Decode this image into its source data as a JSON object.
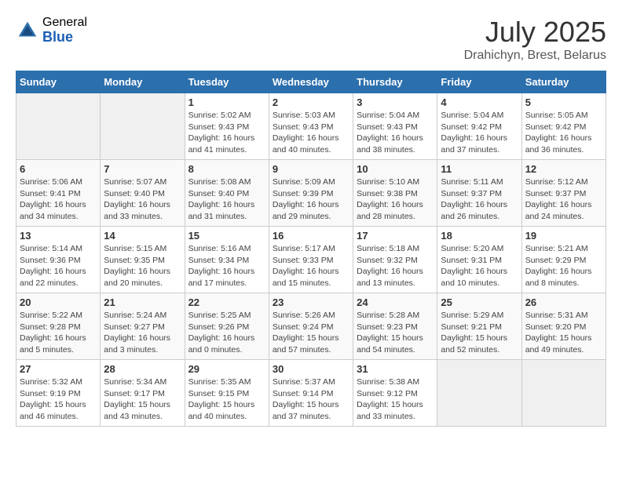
{
  "header": {
    "logo_general": "General",
    "logo_blue": "Blue",
    "month_year": "July 2025",
    "location": "Drahichyn, Brest, Belarus"
  },
  "days_of_week": [
    "Sunday",
    "Monday",
    "Tuesday",
    "Wednesday",
    "Thursday",
    "Friday",
    "Saturday"
  ],
  "weeks": [
    [
      {
        "day": "",
        "info": ""
      },
      {
        "day": "",
        "info": ""
      },
      {
        "day": "1",
        "info": "Sunrise: 5:02 AM\nSunset: 9:43 PM\nDaylight: 16 hours\nand 41 minutes."
      },
      {
        "day": "2",
        "info": "Sunrise: 5:03 AM\nSunset: 9:43 PM\nDaylight: 16 hours\nand 40 minutes."
      },
      {
        "day": "3",
        "info": "Sunrise: 5:04 AM\nSunset: 9:43 PM\nDaylight: 16 hours\nand 38 minutes."
      },
      {
        "day": "4",
        "info": "Sunrise: 5:04 AM\nSunset: 9:42 PM\nDaylight: 16 hours\nand 37 minutes."
      },
      {
        "day": "5",
        "info": "Sunrise: 5:05 AM\nSunset: 9:42 PM\nDaylight: 16 hours\nand 36 minutes."
      }
    ],
    [
      {
        "day": "6",
        "info": "Sunrise: 5:06 AM\nSunset: 9:41 PM\nDaylight: 16 hours\nand 34 minutes."
      },
      {
        "day": "7",
        "info": "Sunrise: 5:07 AM\nSunset: 9:40 PM\nDaylight: 16 hours\nand 33 minutes."
      },
      {
        "day": "8",
        "info": "Sunrise: 5:08 AM\nSunset: 9:40 PM\nDaylight: 16 hours\nand 31 minutes."
      },
      {
        "day": "9",
        "info": "Sunrise: 5:09 AM\nSunset: 9:39 PM\nDaylight: 16 hours\nand 29 minutes."
      },
      {
        "day": "10",
        "info": "Sunrise: 5:10 AM\nSunset: 9:38 PM\nDaylight: 16 hours\nand 28 minutes."
      },
      {
        "day": "11",
        "info": "Sunrise: 5:11 AM\nSunset: 9:37 PM\nDaylight: 16 hours\nand 26 minutes."
      },
      {
        "day": "12",
        "info": "Sunrise: 5:12 AM\nSunset: 9:37 PM\nDaylight: 16 hours\nand 24 minutes."
      }
    ],
    [
      {
        "day": "13",
        "info": "Sunrise: 5:14 AM\nSunset: 9:36 PM\nDaylight: 16 hours\nand 22 minutes."
      },
      {
        "day": "14",
        "info": "Sunrise: 5:15 AM\nSunset: 9:35 PM\nDaylight: 16 hours\nand 20 minutes."
      },
      {
        "day": "15",
        "info": "Sunrise: 5:16 AM\nSunset: 9:34 PM\nDaylight: 16 hours\nand 17 minutes."
      },
      {
        "day": "16",
        "info": "Sunrise: 5:17 AM\nSunset: 9:33 PM\nDaylight: 16 hours\nand 15 minutes."
      },
      {
        "day": "17",
        "info": "Sunrise: 5:18 AM\nSunset: 9:32 PM\nDaylight: 16 hours\nand 13 minutes."
      },
      {
        "day": "18",
        "info": "Sunrise: 5:20 AM\nSunset: 9:31 PM\nDaylight: 16 hours\nand 10 minutes."
      },
      {
        "day": "19",
        "info": "Sunrise: 5:21 AM\nSunset: 9:29 PM\nDaylight: 16 hours\nand 8 minutes."
      }
    ],
    [
      {
        "day": "20",
        "info": "Sunrise: 5:22 AM\nSunset: 9:28 PM\nDaylight: 16 hours\nand 5 minutes."
      },
      {
        "day": "21",
        "info": "Sunrise: 5:24 AM\nSunset: 9:27 PM\nDaylight: 16 hours\nand 3 minutes."
      },
      {
        "day": "22",
        "info": "Sunrise: 5:25 AM\nSunset: 9:26 PM\nDaylight: 16 hours\nand 0 minutes."
      },
      {
        "day": "23",
        "info": "Sunrise: 5:26 AM\nSunset: 9:24 PM\nDaylight: 15 hours\nand 57 minutes."
      },
      {
        "day": "24",
        "info": "Sunrise: 5:28 AM\nSunset: 9:23 PM\nDaylight: 15 hours\nand 54 minutes."
      },
      {
        "day": "25",
        "info": "Sunrise: 5:29 AM\nSunset: 9:21 PM\nDaylight: 15 hours\nand 52 minutes."
      },
      {
        "day": "26",
        "info": "Sunrise: 5:31 AM\nSunset: 9:20 PM\nDaylight: 15 hours\nand 49 minutes."
      }
    ],
    [
      {
        "day": "27",
        "info": "Sunrise: 5:32 AM\nSunset: 9:19 PM\nDaylight: 15 hours\nand 46 minutes."
      },
      {
        "day": "28",
        "info": "Sunrise: 5:34 AM\nSunset: 9:17 PM\nDaylight: 15 hours\nand 43 minutes."
      },
      {
        "day": "29",
        "info": "Sunrise: 5:35 AM\nSunset: 9:15 PM\nDaylight: 15 hours\nand 40 minutes."
      },
      {
        "day": "30",
        "info": "Sunrise: 5:37 AM\nSunset: 9:14 PM\nDaylight: 15 hours\nand 37 minutes."
      },
      {
        "day": "31",
        "info": "Sunrise: 5:38 AM\nSunset: 9:12 PM\nDaylight: 15 hours\nand 33 minutes."
      },
      {
        "day": "",
        "info": ""
      },
      {
        "day": "",
        "info": ""
      }
    ]
  ]
}
